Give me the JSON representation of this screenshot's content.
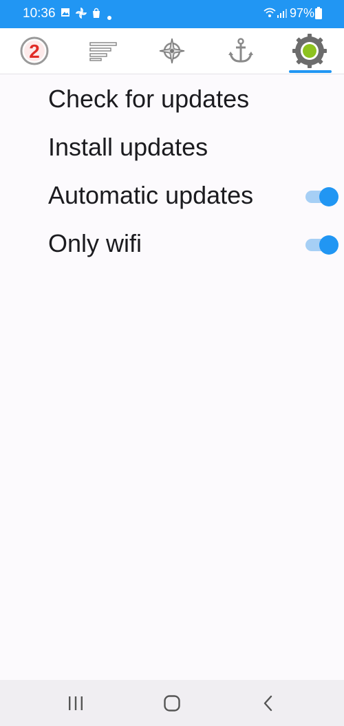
{
  "status_bar": {
    "time": "10:36",
    "battery": "97%",
    "icons": [
      "gallery-icon",
      "pinwheel-icon",
      "shopping-bag-icon",
      "notification-dot-icon",
      "wifi-icon",
      "signal-icon",
      "battery-icon"
    ]
  },
  "tabs": [
    {
      "icon": "race-badge-2-icon",
      "badge": "2"
    },
    {
      "icon": "lines-list-icon"
    },
    {
      "icon": "compass-icon"
    },
    {
      "icon": "anchor-icon"
    },
    {
      "icon": "settings-gear-icon",
      "active": true
    }
  ],
  "settings": {
    "check_updates": "Check for updates",
    "install_updates": "Install updates",
    "automatic_updates": {
      "label": "Automatic updates",
      "checked": true
    },
    "only_wifi": {
      "label": "Only wifi",
      "checked": true
    }
  },
  "colors": {
    "accent": "#2196f3",
    "background": "#fcfafd",
    "switch_track": "#a6cff5",
    "gear_dot": "#8dc21f"
  },
  "nav_bar": {
    "icons": [
      "recent-apps-icon",
      "home-icon",
      "back-icon"
    ]
  }
}
